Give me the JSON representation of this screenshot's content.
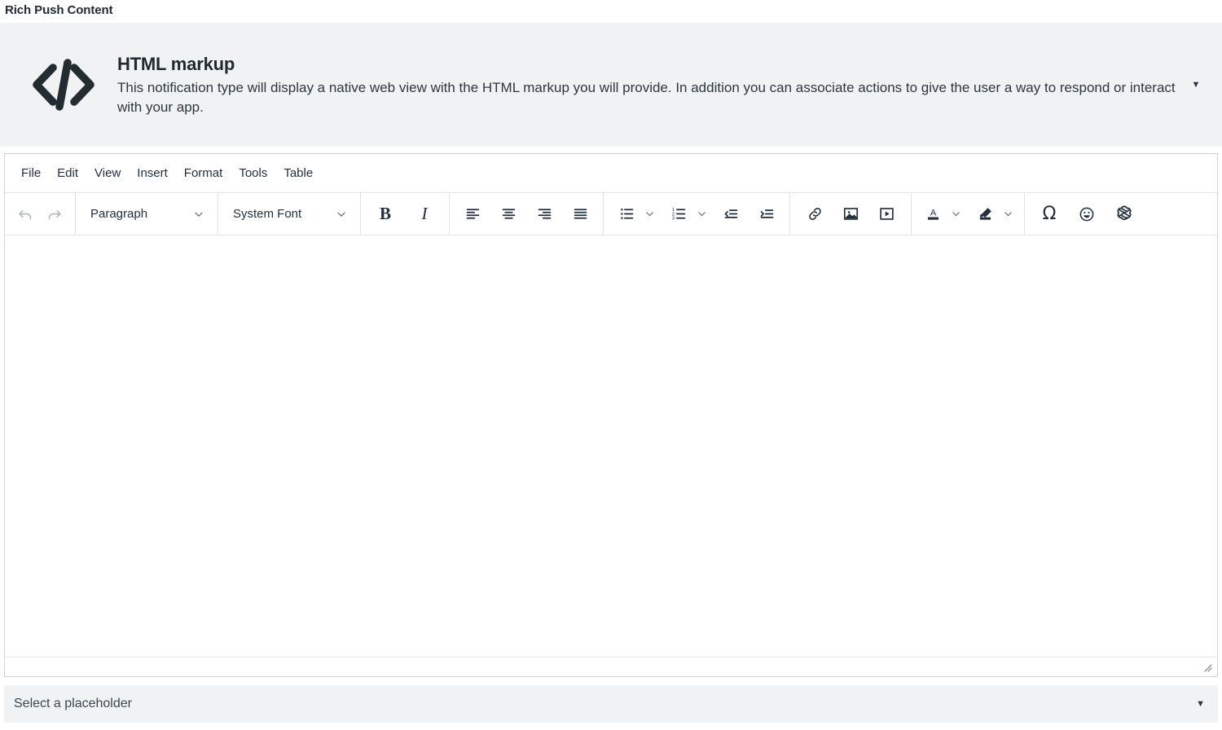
{
  "page": {
    "title": "Rich Push Content"
  },
  "notification_type": {
    "icon": "code-brackets-icon",
    "title": "HTML markup",
    "description": "This notification type will display a native web view with the HTML markup you will provide. In addition you can associate actions to give the user a way to respond or interact with your app.",
    "caret": "▼"
  },
  "editor": {
    "menubar": [
      {
        "label": "File",
        "name": "menu-file"
      },
      {
        "label": "Edit",
        "name": "menu-edit"
      },
      {
        "label": "View",
        "name": "menu-view"
      },
      {
        "label": "Insert",
        "name": "menu-insert"
      },
      {
        "label": "Format",
        "name": "menu-format"
      },
      {
        "label": "Tools",
        "name": "menu-tools"
      },
      {
        "label": "Table",
        "name": "menu-table"
      }
    ],
    "toolbar": {
      "undo": "undo-icon",
      "redo": "redo-icon",
      "block_format": {
        "value": "Paragraph",
        "caret": "⌄"
      },
      "font_family": {
        "value": "System Font",
        "caret": "⌄"
      },
      "bold": "B",
      "italic": "I",
      "align_left": "align-left-icon",
      "align_center": "align-center-icon",
      "align_right": "align-right-icon",
      "align_justify": "align-justify-icon",
      "bullet_list": "bullet-list-icon",
      "numbered_list": "numbered-list-icon",
      "outdent": "outdent-icon",
      "indent": "indent-icon",
      "link": "link-icon",
      "image": "image-icon",
      "media": "media-icon",
      "text_color": "text-color-icon",
      "highlight_color": "highlight-color-icon",
      "special_character": "Ω",
      "emoticon": "emoticon-icon",
      "ai_assistant": "openai-logo-icon"
    },
    "content": "",
    "status_bar": {
      "resize_handle": "resize-handle-icon"
    }
  },
  "placeholder_select": {
    "value": "Select a placeholder",
    "caret": "▼"
  },
  "colors": {
    "banner_bg": "#f1f2f4",
    "text_dark": "#222f3e",
    "border": "#cfd3d7",
    "divider": "#e3e5e8",
    "disabled": "#aeb7be"
  }
}
